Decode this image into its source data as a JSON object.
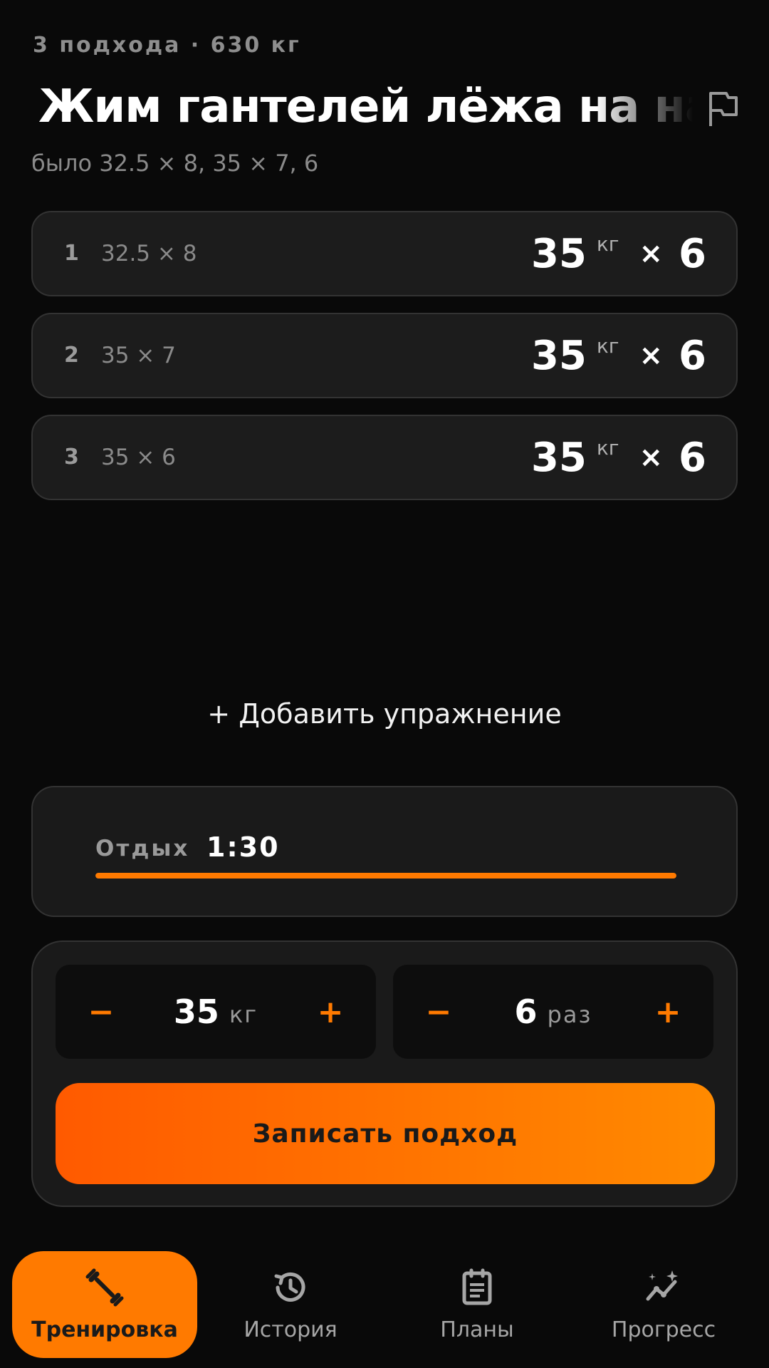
{
  "header": {
    "meta": "3 подхода · 630 кг",
    "title": "Жим гантелей лёжа на наклонной скамье",
    "previous": "было 32.5 × 8, 35 × 7, 6",
    "flag_icon": "flag-icon"
  },
  "sets": [
    {
      "num": "1",
      "prev": "32.5 × 8",
      "weight": "35",
      "unit": "кг",
      "times": "×",
      "reps": "6"
    },
    {
      "num": "2",
      "prev": "35 × 7",
      "weight": "35",
      "unit": "кг",
      "times": "×",
      "reps": "6"
    },
    {
      "num": "3",
      "prev": "35 × 6",
      "weight": "35",
      "unit": "кг",
      "times": "×",
      "reps": "6"
    }
  ],
  "add_exercise": "+ Добавить упражнение",
  "rest": {
    "label": "Отдых",
    "time": "1:30",
    "progress": 1.0
  },
  "log": {
    "weight": {
      "minus": "−",
      "value": "35",
      "unit": "кг",
      "plus": "+"
    },
    "reps": {
      "minus": "−",
      "value": "6",
      "unit": "раз",
      "plus": "+"
    },
    "submit": "Записать подход"
  },
  "nav": {
    "items": [
      {
        "label": "Тренировка",
        "icon": "dumbbell-icon",
        "active": true
      },
      {
        "label": "История",
        "icon": "history-icon",
        "active": false
      },
      {
        "label": "Планы",
        "icon": "clipboard-icon",
        "active": false
      },
      {
        "label": "Прогресс",
        "icon": "progress-chart-icon",
        "active": false
      }
    ]
  },
  "colors": {
    "accent": "#ff7a00",
    "background": "#090909",
    "card": "#1c1c1c"
  }
}
